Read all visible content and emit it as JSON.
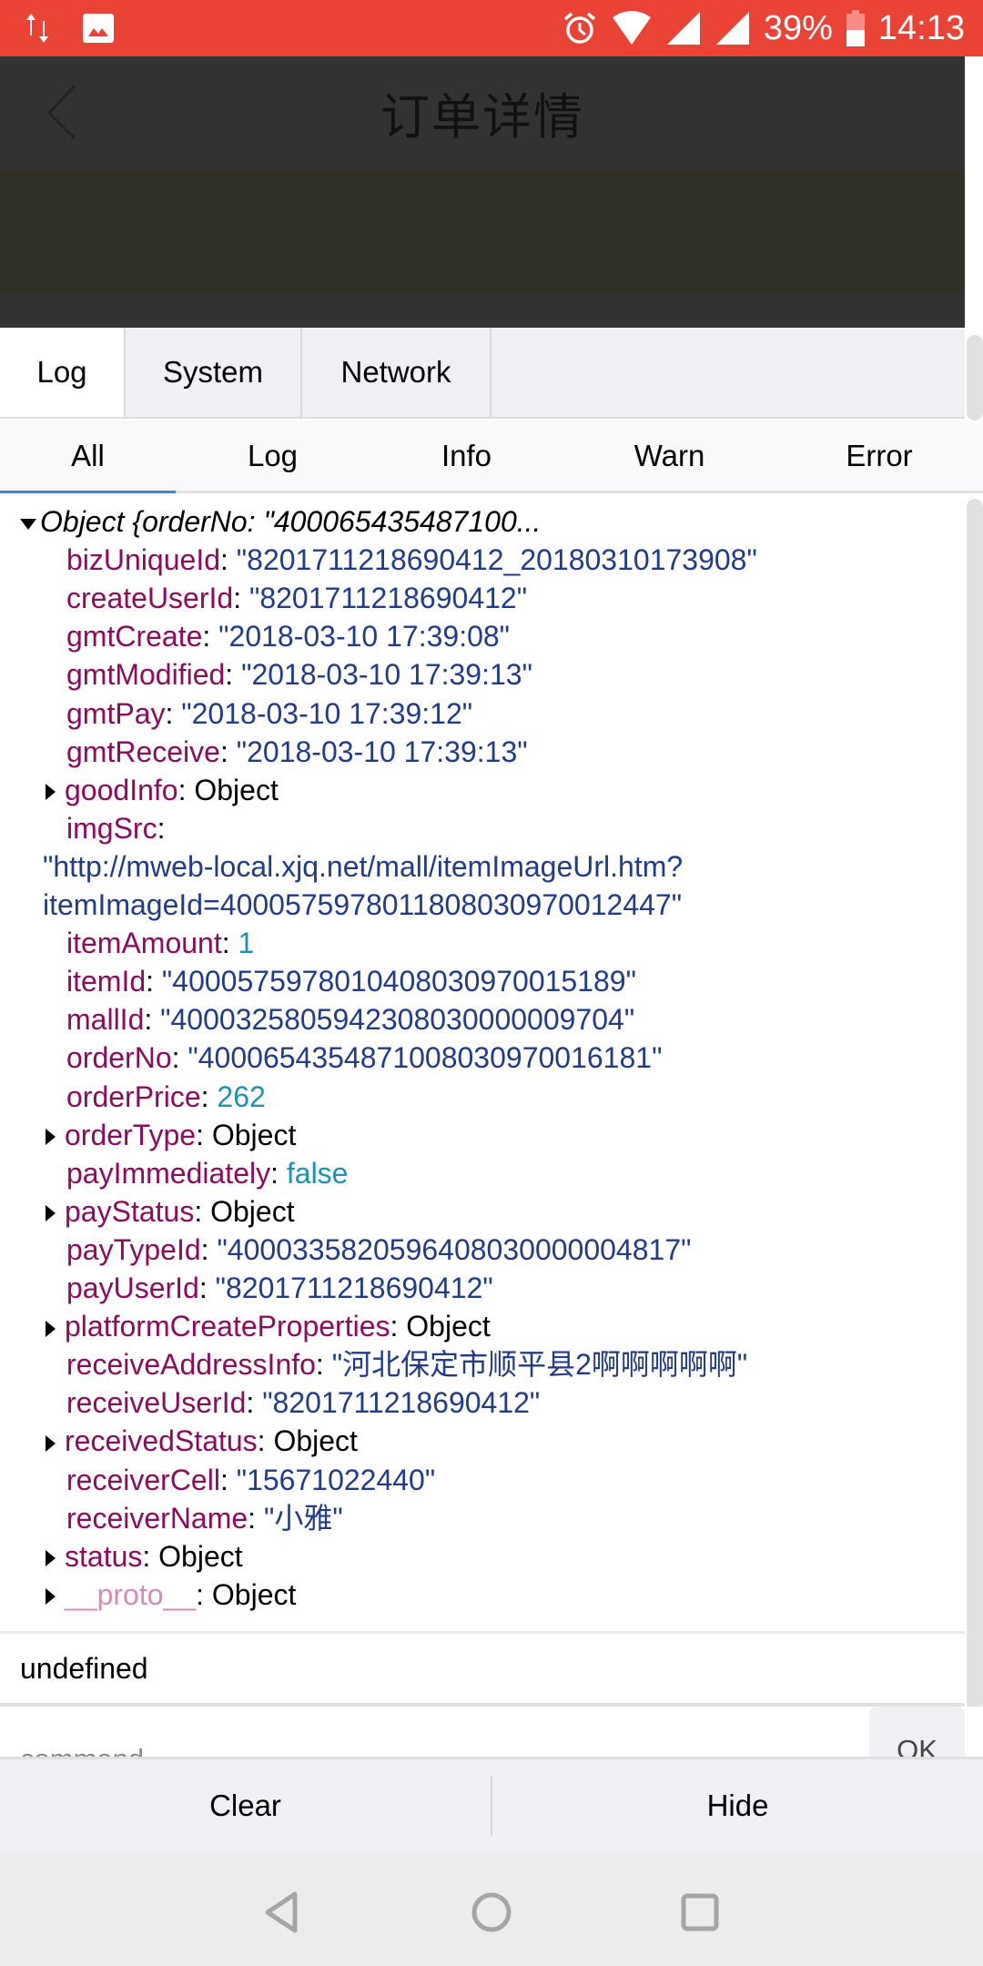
{
  "status_bar": {
    "battery_percent": "39%",
    "battery_level": 0.39,
    "time": "14:13",
    "icons_left": [
      "data-transfer-icon",
      "image-icon"
    ],
    "icons_right": [
      "alarm-icon",
      "wifi-icon",
      "signal-icon",
      "signal-icon-2",
      "battery-icon"
    ],
    "color": "#ea4335"
  },
  "app_bar": {
    "title": "订单详情",
    "back_icon": "chevron-left-icon"
  },
  "console": {
    "tabs": [
      {
        "label": "Log",
        "active": true
      },
      {
        "label": "System",
        "active": false
      },
      {
        "label": "Network",
        "active": false
      }
    ],
    "filters": [
      {
        "label": "All",
        "active": true
      },
      {
        "label": "Log",
        "active": false
      },
      {
        "label": "Info",
        "active": false
      },
      {
        "label": "Warn",
        "active": false
      },
      {
        "label": "Error",
        "active": false
      }
    ],
    "log": {
      "header": "Object {orderNo: \"400065435487100...",
      "entries": [
        {
          "key": "bizUniqueId",
          "value": "\"8201711218690412_20180310173908\"",
          "type": "string"
        },
        {
          "key": "createUserId",
          "value": "\"8201711218690412\"",
          "type": "string"
        },
        {
          "key": "gmtCreate",
          "value": "\"2018-03-10 17:39:08\"",
          "type": "string"
        },
        {
          "key": "gmtModified",
          "value": "\"2018-03-10 17:39:13\"",
          "type": "string"
        },
        {
          "key": "gmtPay",
          "value": "\"2018-03-10 17:39:12\"",
          "type": "string"
        },
        {
          "key": "gmtReceive",
          "value": "\"2018-03-10 17:39:13\"",
          "type": "string"
        },
        {
          "key": "goodInfo",
          "value": "Object",
          "type": "object"
        },
        {
          "key": "imgSrc",
          "value": "",
          "type": "string"
        },
        {
          "key": "itemAmount",
          "value": "1",
          "type": "number"
        },
        {
          "key": "itemId",
          "value": "\"4000575978010408030970015189\"",
          "type": "string"
        },
        {
          "key": "mallId",
          "value": "\"4000325805942308030000009704\"",
          "type": "string"
        },
        {
          "key": "orderNo",
          "value": "\"4000654354871008030970016181\"",
          "type": "string"
        },
        {
          "key": "orderPrice",
          "value": "262",
          "type": "number"
        },
        {
          "key": "orderType",
          "value": "Object",
          "type": "object"
        },
        {
          "key": "payImmediately",
          "value": "false",
          "type": "boolean"
        },
        {
          "key": "payStatus",
          "value": "Object",
          "type": "object"
        },
        {
          "key": "payTypeId",
          "value": "\"4000335820596408030000004817\"",
          "type": "string"
        },
        {
          "key": "payUserId",
          "value": "\"8201711218690412\"",
          "type": "string"
        },
        {
          "key": "platformCreateProperties",
          "value": "Object",
          "type": "object"
        },
        {
          "key": "receiveAddressInfo",
          "value": "\"河北保定市顺平县2啊啊啊啊啊\"",
          "type": "string"
        },
        {
          "key": "receiveUserId",
          "value": "\"8201711218690412\"",
          "type": "string"
        },
        {
          "key": "receivedStatus",
          "value": "Object",
          "type": "object"
        },
        {
          "key": "receiverCell",
          "value": "\"15671022440\"",
          "type": "string"
        },
        {
          "key": "receiverName",
          "value": "\"小雅\"",
          "type": "string"
        },
        {
          "key": "status",
          "value": "Object",
          "type": "object"
        },
        {
          "key": "__proto__",
          "value": "Object",
          "type": "object"
        }
      ],
      "imgSrc_lines": [
        "\"http://mweb-local.xjq.net/mall/itemImageUrl.htm?",
        "itemImageId=4000575978011808030970012447\""
      ],
      "result": "undefined"
    },
    "command": {
      "placeholder": "command",
      "value": "",
      "ok_label": "OK"
    },
    "toolbar": {
      "clear_label": "Clear",
      "hide_label": "Hide"
    },
    "colors": {
      "key": "#8b0c5d",
      "string": "#213b89",
      "number": "#1a93ae",
      "proto_key": "#d08db6",
      "active_filter_underline": "#3b84e8"
    }
  },
  "nav_bar": {
    "buttons": [
      "back-triangle-icon",
      "home-circle-icon",
      "recents-square-icon"
    ]
  }
}
